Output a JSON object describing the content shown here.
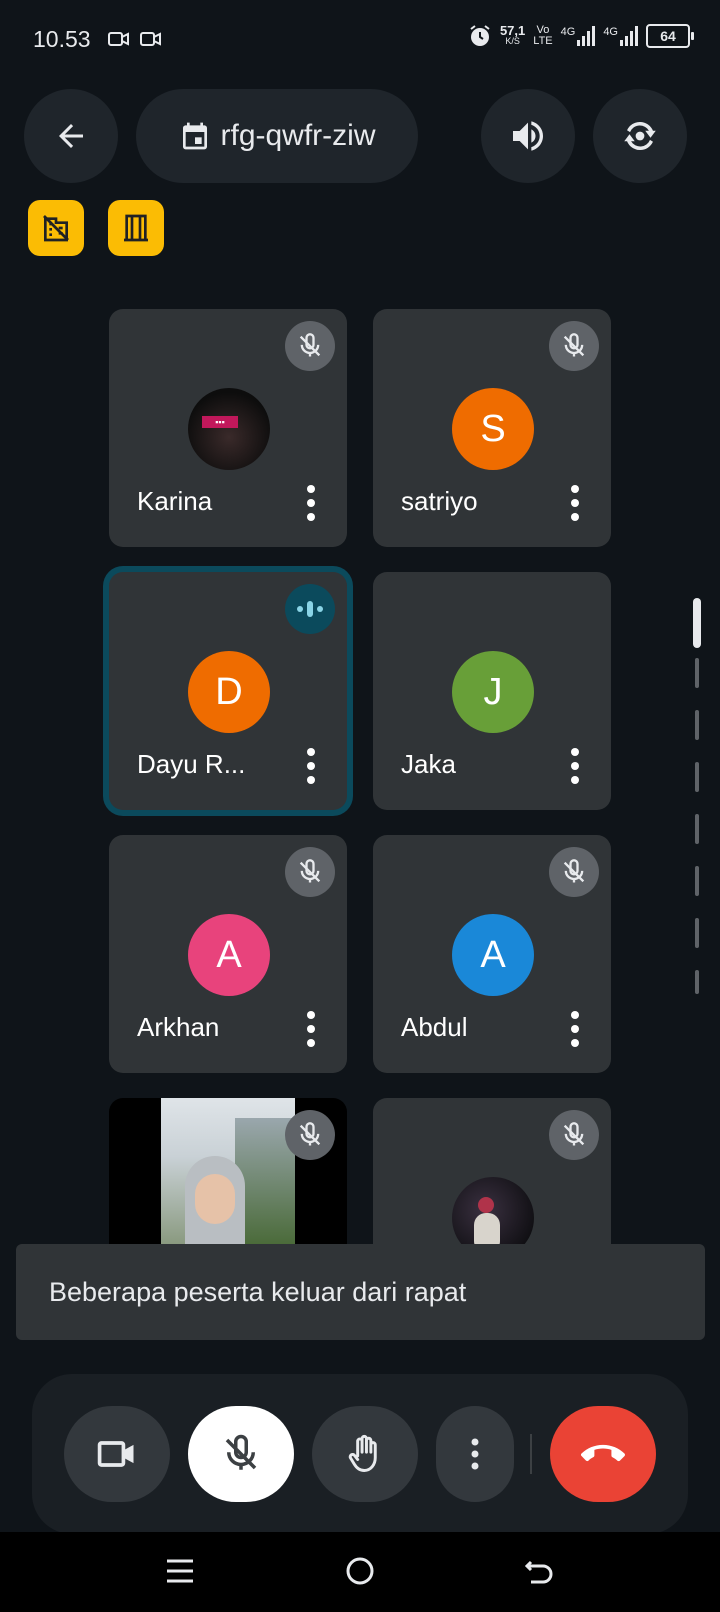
{
  "status_bar": {
    "time": "10.53",
    "net_speed_value": "57,1",
    "net_speed_unit": "K/S",
    "volte_top": "Vo",
    "volte_bottom": "LTE",
    "net1": "4G",
    "net2": "4G",
    "battery": "64"
  },
  "header": {
    "meeting_code": "rfg-qwfr-ziw"
  },
  "tiles": [
    {
      "name": "Karina",
      "initial": "",
      "color": "#000000",
      "muted": true
    },
    {
      "name": "satriyo",
      "initial": "S",
      "color": "#ef6c00",
      "muted": true
    },
    {
      "name": "Dayu R...",
      "initial": "D",
      "color": "#ef6c00",
      "muted": false,
      "speaking": true
    },
    {
      "name": "Jaka",
      "initial": "J",
      "color": "#689f38",
      "muted": false
    },
    {
      "name": "Arkhan",
      "initial": "A",
      "color": "#e8437c",
      "muted": true
    },
    {
      "name": "Abdul",
      "initial": "A",
      "color": "#1a88d8",
      "muted": true
    }
  ],
  "snackbar": {
    "message": "Beberapa peserta keluar dari rapat"
  },
  "colors": {
    "background": "#0f1419",
    "tile": "#303437",
    "end_call": "#ea4335",
    "badge": "#fbbc04"
  }
}
